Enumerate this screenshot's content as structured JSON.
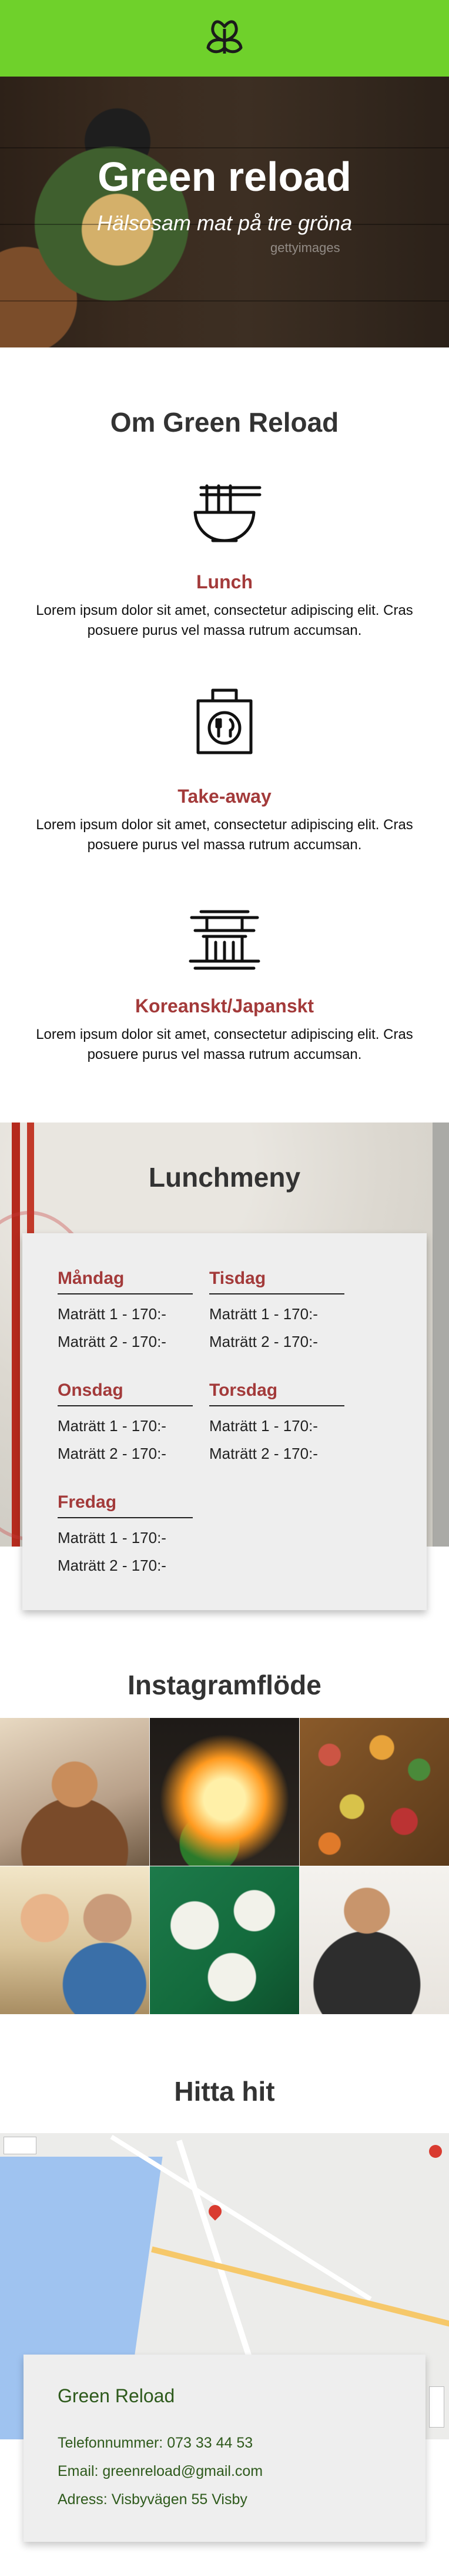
{
  "hero": {
    "title": "Green reload",
    "subtitle": "Hälsosam mat på tre gröna",
    "watermark": "gettyimages"
  },
  "about": {
    "title": "Om Green Reload",
    "features": [
      {
        "icon": "noodle-bowl-icon",
        "title": "Lunch",
        "text": "Lorem ipsum dolor sit amet, consectetur adipiscing elit. Cras posuere purus vel massa rutrum accumsan."
      },
      {
        "icon": "takeaway-bag-icon",
        "title": "Take-away",
        "text": "Lorem ipsum dolor sit amet, consectetur adipiscing elit. Cras posuere purus vel massa rutrum accumsan."
      },
      {
        "icon": "pagoda-icon",
        "title": "Koreanskt/Japanskt",
        "text": "Lorem ipsum dolor sit amet, consectetur adipiscing elit. Cras posuere purus vel massa rutrum accumsan."
      }
    ]
  },
  "lunch": {
    "title": "Lunchmeny",
    "days": [
      {
        "name": "Måndag",
        "dishes": [
          "Maträtt 1 - 170:-",
          "Maträtt 2 - 170:-"
        ]
      },
      {
        "name": "Tisdag",
        "dishes": [
          "Maträtt 1 - 170:-",
          "Maträtt 2 - 170:-"
        ]
      },
      {
        "name": "Onsdag",
        "dishes": [
          "Maträtt 1 - 170:-",
          "Maträtt 2 - 170:-"
        ]
      },
      {
        "name": "Torsdag",
        "dishes": [
          "Maträtt 1 - 170:-",
          "Maträtt 2 - 170:-"
        ]
      },
      {
        "name": "Fredag",
        "dishes": [
          "Maträtt 1 - 170:-",
          "Maträtt 2 - 170:-"
        ]
      }
    ]
  },
  "instagram": {
    "title": "Instagramflöde"
  },
  "find": {
    "title": "Hitta hit",
    "name": "Green Reload",
    "phone": "Telefonnummer: 073 33 44 53",
    "email": "Email: greenreload@gmail.com",
    "address": "Adress: Visbyvägen 55 Visby"
  },
  "colors": {
    "header": "#6fd12b",
    "accent": "#a33a3a",
    "contact_text": "#2e5a1c"
  }
}
